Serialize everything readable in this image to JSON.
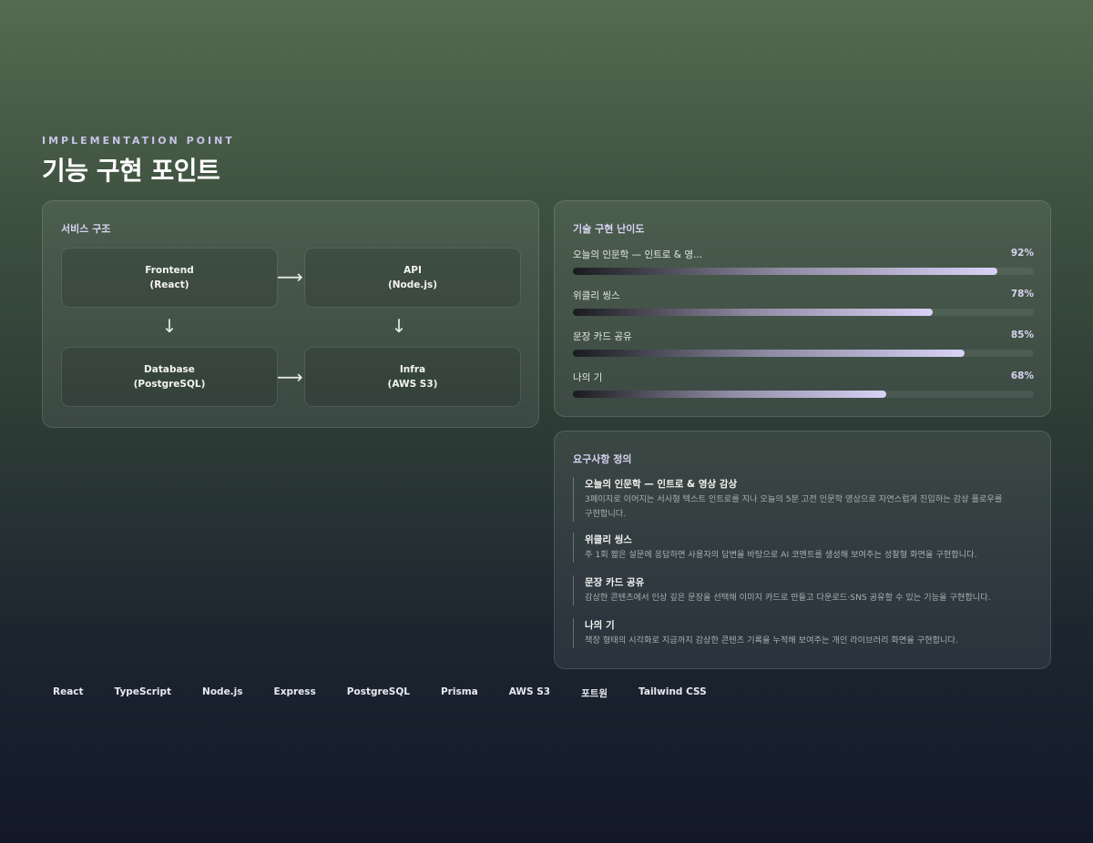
{
  "header": {
    "eyebrow": "IMPLEMENTATION POINT",
    "title": "기능 구현 포인트"
  },
  "architecture": {
    "title": "서비스 구조",
    "nodes": [
      {
        "name": "Frontend",
        "sub": "(React)"
      },
      {
        "name": "API",
        "sub": "(Node.js)"
      },
      {
        "name": "Database",
        "sub": "(PostgreSQL)"
      },
      {
        "name": "Infra",
        "sub": "(AWS S3)"
      }
    ],
    "arrow_right": "⟶",
    "arrow_down": "↓"
  },
  "difficulty": {
    "title": "기술 구현 난이도",
    "items": [
      {
        "label": "오늘의 인문학 — 인트로 & 영...",
        "percent_label": "92%",
        "value": 92
      },
      {
        "label": "위클리 씽스",
        "percent_label": "78%",
        "value": 78
      },
      {
        "label": "문장 카드 공유",
        "percent_label": "85%",
        "value": 85
      },
      {
        "label": "나의 기",
        "percent_label": "68%",
        "value": 68
      }
    ]
  },
  "requirements": {
    "title": "요구사항 정의",
    "items": [
      {
        "title": "오늘의 인문학 — 인트로 & 영상 감상",
        "desc": "3페이지로 이어지는 서사형 텍스트 인트로를 지나 오늘의 5분 고전 인문학 영상으로 자연스럽게 진입하는 감상 플로우를",
        "desc2": "구현합니다."
      },
      {
        "title": "위클리 씽스",
        "desc": "주 1회 짧은 설문에 응답하면 사용자의 답변을 바탕으로 AI 코멘트를 생성해 보여주는 성찰형 화면을 구현합니다.",
        "desc2": ""
      },
      {
        "title": "문장 카드 공유",
        "desc": "감상한 콘텐츠에서 인상 깊은 문장을 선택해 이미지 카드로 만들고 다운로드·SNS 공유할 수 있는 기능을 구현합니다.",
        "desc2": ""
      },
      {
        "title": "나의 기",
        "desc": "책장 형태의 시각화로 지금까지 감상한 콘텐츠 기록을 누적해 보여주는 개인 라이브러리 화면을 구현합니다.",
        "desc2": ""
      }
    ]
  },
  "tags": [
    "React",
    "TypeScript",
    "Node.js",
    "Express",
    "PostgreSQL",
    "Prisma",
    "AWS S3",
    "포트원",
    "Tailwind CSS"
  ]
}
